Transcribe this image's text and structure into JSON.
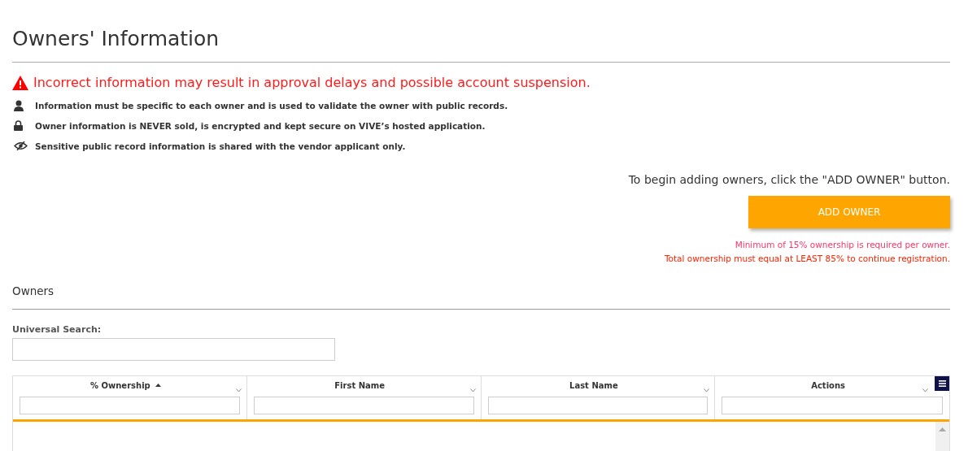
{
  "page": {
    "title": "Owners' Information"
  },
  "warning": "Incorrect information may result in approval delays and possible account suspension.",
  "notices": [
    {
      "kind": "person",
      "text": "Information must be specific to each owner and is used to validate the owner with public records."
    },
    {
      "kind": "lock",
      "text": "Owner information is NEVER sold, is encrypted and kept secure on VIVE’s hosted application."
    },
    {
      "kind": "eye",
      "text": "Sensitive public record information is shared with the vendor applicant only."
    }
  ],
  "instruction": "To begin adding owners, click the \"ADD OWNER\" button.",
  "add_button": "ADD OWNER",
  "requirements": [
    {
      "text": "Minimum of 15% ownership is required per owner.",
      "color": "#ff3366"
    },
    {
      "text": "Total ownership must equal at LEAST 85% to continue registration.",
      "color": "#ff2200"
    }
  ],
  "owners": {
    "title": "Owners",
    "search_label": "Universal Search:",
    "columns": [
      {
        "label": "% Ownership",
        "sorted": true
      },
      {
        "label": "First Name",
        "sorted": false
      },
      {
        "label": "Last Name",
        "sorted": false
      },
      {
        "label": "Actions",
        "sorted": false
      }
    ]
  }
}
